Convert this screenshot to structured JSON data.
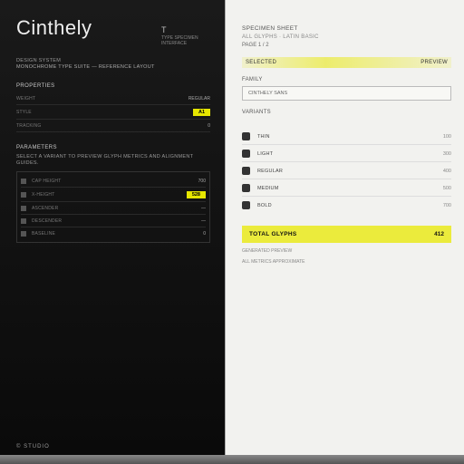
{
  "brand": "Cinthely",
  "colors": {
    "accent_yellow": "#e6e600",
    "dark": "#0a0a0a",
    "light": "#f2f2ef"
  },
  "tiny": {
    "glyph_label": "T",
    "line1": "TYPE SPECIMEN",
    "line2": "INTERFACE"
  },
  "left": {
    "intro1": "DESIGN SYSTEM",
    "intro2": "MONOCHROME TYPE SUITE — REFERENCE LAYOUT",
    "sec1_head": "PROPERTIES",
    "sec1": [
      {
        "lab": "WEIGHT",
        "val": "REGULAR"
      },
      {
        "lab": "STYLE",
        "mark": "A1",
        "val": ""
      },
      {
        "lab": "TRACKING",
        "val": "0"
      }
    ],
    "sec2_head": "PARAMETERS",
    "sec2_note": "SELECT A VARIANT TO PREVIEW GLYPH METRICS AND ALIGNMENT GUIDES.",
    "sec2": [
      {
        "lab": "CAP HEIGHT",
        "val": "700"
      },
      {
        "lab": "X-HEIGHT",
        "mark": "528",
        "val": ""
      },
      {
        "lab": "ASCENDER",
        "val": "—"
      },
      {
        "lab": "DESCENDER",
        "val": "—"
      },
      {
        "lab": "BASELINE",
        "val": "0"
      }
    ],
    "foot": "© STUDIO"
  },
  "right": {
    "head_a": "SPECIMEN SHEET",
    "head_b": "ALL GLYPHS · LATIN BASIC",
    "sub": "PAGE 1 / 2",
    "hl_left": "SELECTED",
    "hl_right": "PREVIEW",
    "label": "FAMILY",
    "box": "CINTHELY SANS",
    "list_head": "VARIANTS",
    "items": [
      {
        "nm": "THIN",
        "rv": "100"
      },
      {
        "nm": "LIGHT",
        "rv": "300"
      },
      {
        "nm": "REGULAR",
        "rv": "400"
      },
      {
        "nm": "MEDIUM",
        "rv": "500"
      },
      {
        "nm": "BOLD",
        "rv": "700"
      }
    ],
    "band_label": "TOTAL GLYPHS",
    "band_value": "412",
    "foot1": "GENERATED PREVIEW",
    "foot2": "ALL METRICS APPROXIMATE"
  }
}
